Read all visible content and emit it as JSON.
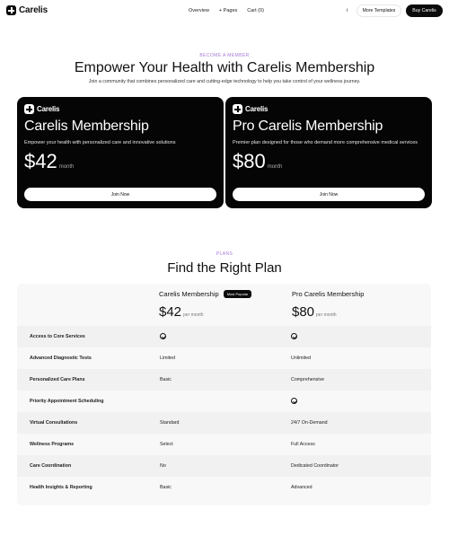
{
  "nav": {
    "brand": "Carelis",
    "links": [
      "Overview",
      "+ Pages",
      "Cart (0)"
    ],
    "dot": "i",
    "more_templates": "More Templates",
    "buy": "Buy Carelis"
  },
  "hero": {
    "eyebrow": "BECOME A MEMBER",
    "title": "Empower Your Health with Carelis Membership",
    "subtitle": "Join a community that combines personalized care and cutting-edge technology to help you take control of your wellness journey."
  },
  "membership_cards": [
    {
      "brand": "Carelis",
      "title": "Carelis Membership",
      "description": "Empower your health with personalized care and innovative solutions",
      "price": "$42",
      "period": "month",
      "button": "Join Now"
    },
    {
      "brand": "Carelis",
      "title": "Pro Carelis Membership",
      "description": "Premier plan designed for those who demand more comprehensive medical services",
      "price": "$80",
      "period": "month",
      "button": "Join Now"
    }
  ],
  "plans": {
    "eyebrow": "PLANS",
    "title": "Find the Right Plan",
    "columns": [
      {
        "name": "Carelis Membership",
        "badge": "Most Popular",
        "price": "$42",
        "period": "per month"
      },
      {
        "name": "Pro Carelis Membership",
        "badge": "",
        "price": "$80",
        "period": "per month"
      }
    ],
    "rows": [
      {
        "label": "Access to Core Services",
        "basic": "check",
        "pro": "check"
      },
      {
        "label": "Advanced Diagnostic Tests",
        "basic": "Limited",
        "pro": "Unlimited"
      },
      {
        "label": "Personalized Care Plans",
        "basic": "Basic",
        "pro": "Comprehensive"
      },
      {
        "label": "Priority Appointment Scheduling",
        "basic": "",
        "pro": "check"
      },
      {
        "label": "Virtual Consultations",
        "basic": "Standard",
        "pro": "24/7 On-Demand"
      },
      {
        "label": "Wellness Programs",
        "basic": "Select",
        "pro": "Full Access"
      },
      {
        "label": "Care Coordination",
        "basic": "No",
        "pro": "Dedicated Coordinator"
      },
      {
        "label": "Health Insights & Reporting",
        "basic": "Basic",
        "pro": "Advanced"
      }
    ]
  }
}
